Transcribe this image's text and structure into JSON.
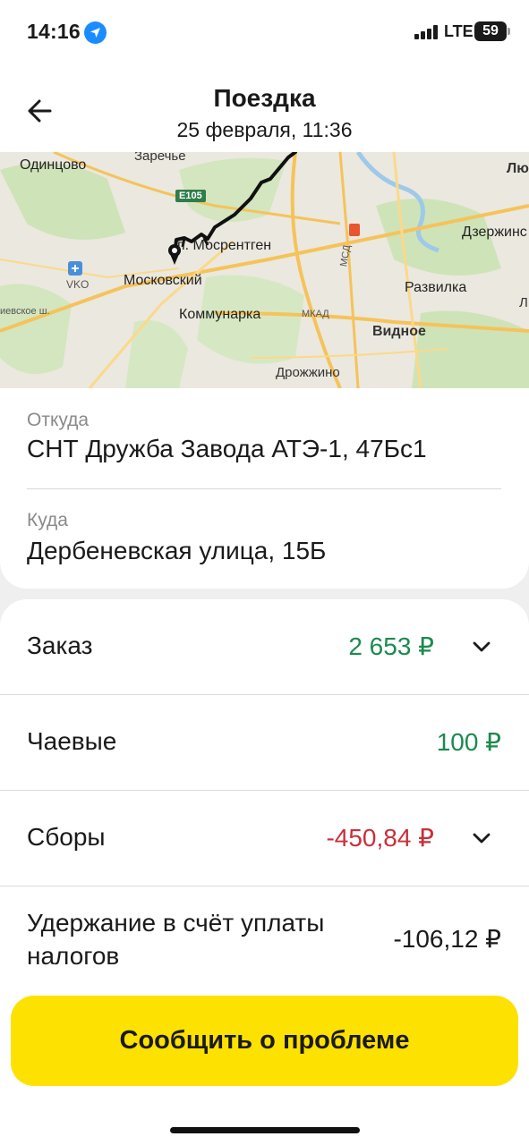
{
  "status_bar": {
    "time": "14:16",
    "network": "LTE",
    "battery": "59"
  },
  "header": {
    "title": "Поездка",
    "subtitle": "25 февраля, 11:36"
  },
  "map": {
    "labels": {
      "odintsovo": "Одинцово",
      "zarechye": "Заречье",
      "mosrentgen": "п. Мосрентген",
      "moskovsky": "Московский",
      "vko": "VKO",
      "kievskoe": "иевское ш.",
      "kommunarka": "Коммунарка",
      "mkad": "МКАД",
      "msd": "МСД",
      "vidnoe": "Видное",
      "razvilka": "Развилка",
      "dzerzhinsky": "Дзержинс",
      "drozhzhino": "Дрожжино",
      "lyu": "Лю",
      "l": "Л"
    },
    "road_badge": "E105"
  },
  "route": {
    "from_label": "Откуда",
    "from_value": "СНТ Дружба Завода АТЭ-1, 47Бс1",
    "to_label": "Куда",
    "to_value": "Дербеневская улица, 15Б"
  },
  "payment": {
    "order": {
      "label": "Заказ",
      "amount": "2 653 ₽"
    },
    "tips": {
      "label": "Чаевые",
      "amount": "100 ₽"
    },
    "fees": {
      "label": "Сборы",
      "amount": "-450,84 ₽"
    },
    "tax": {
      "label": "Удержание в счёт уплаты налогов",
      "amount": "-106,12 ₽"
    }
  },
  "actions": {
    "report_problem": "Сообщить о проблеме"
  },
  "colors": {
    "accent": "#fde100",
    "positive": "#1b8a4f",
    "negative": "#c8303a"
  }
}
